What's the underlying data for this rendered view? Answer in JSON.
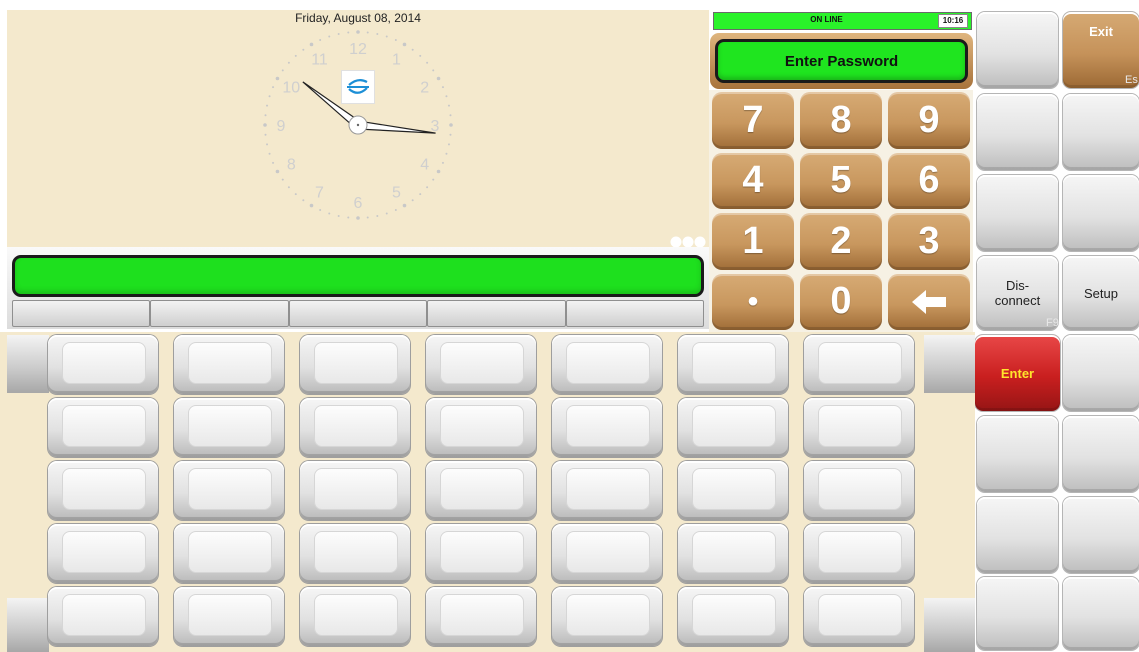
{
  "clock": {
    "date": "Friday, August 08, 2014",
    "numerals": [
      "12",
      "1",
      "2",
      "3",
      "4",
      "5",
      "6",
      "7",
      "8",
      "9",
      "10",
      "11"
    ],
    "time": "10:16"
  },
  "status": {
    "online_label": "ON LINE",
    "time": "10:16"
  },
  "password_prompt": "Enter Password",
  "numpad": {
    "keys": [
      "7",
      "8",
      "9",
      "4",
      "5",
      "6",
      "1",
      "2",
      "3",
      "•",
      "0",
      "←"
    ]
  },
  "function_keys": {
    "exit_label": "Exit",
    "exit_hint": "Es",
    "disconnect_label": "Dis-\nconnect",
    "disconnect_hint": "F9",
    "setup_label": "Setup",
    "enter_label": "Enter"
  },
  "colors": {
    "accent_green": "#1ee01e",
    "numpad_tan": "#c8975e",
    "enter_red": "#c91f1f",
    "panel_beige": "#f4e9cd"
  }
}
